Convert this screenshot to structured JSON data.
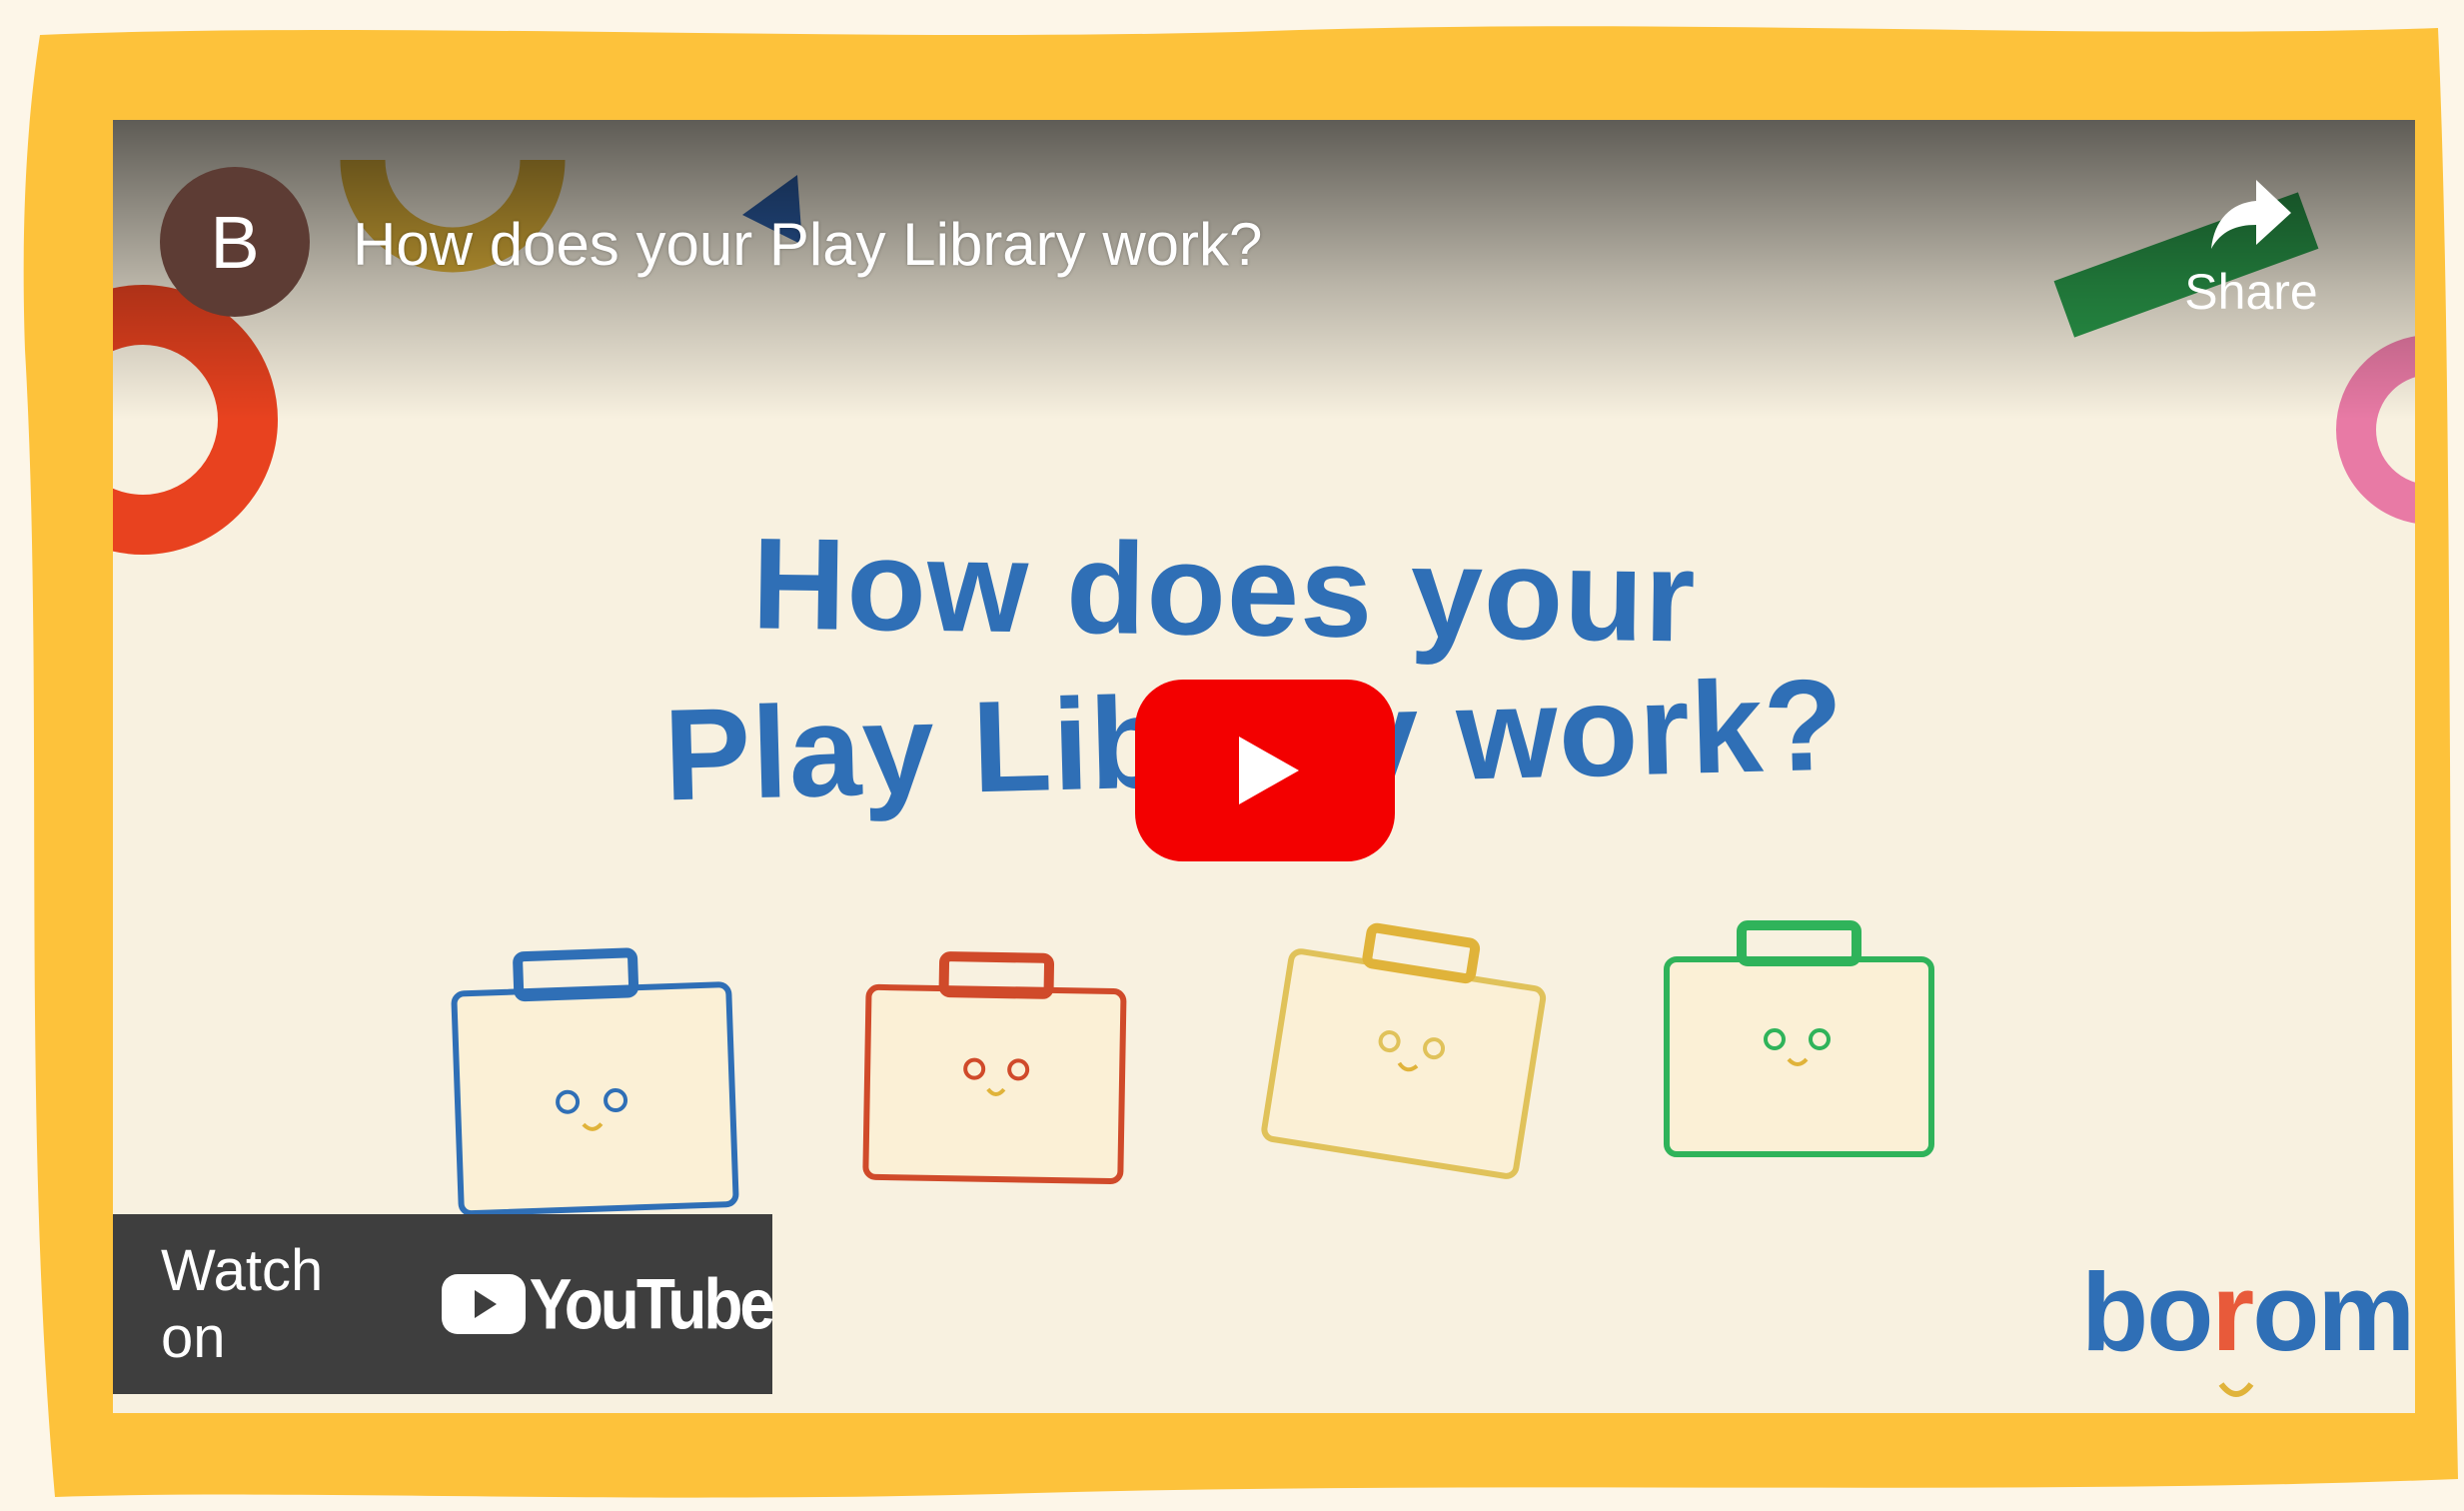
{
  "embed": {
    "channel_initial": "B",
    "title": "How does your Play Library work?",
    "share_label": "Share",
    "headline_line1": "How does your",
    "headline_line2": "Play Library work?",
    "watch_label": "Watch on",
    "youtube_wordmark": "YouTube",
    "brand_logo": "boromi"
  },
  "colors": {
    "frame_yellow": "#fdc23b",
    "headline_blue": "#2f6fb6",
    "play_red": "#f30000",
    "avatar_brown": "#5d3c34"
  },
  "icons": [
    "share-arrow-icon",
    "play-icon",
    "youtube-logo-icon"
  ]
}
